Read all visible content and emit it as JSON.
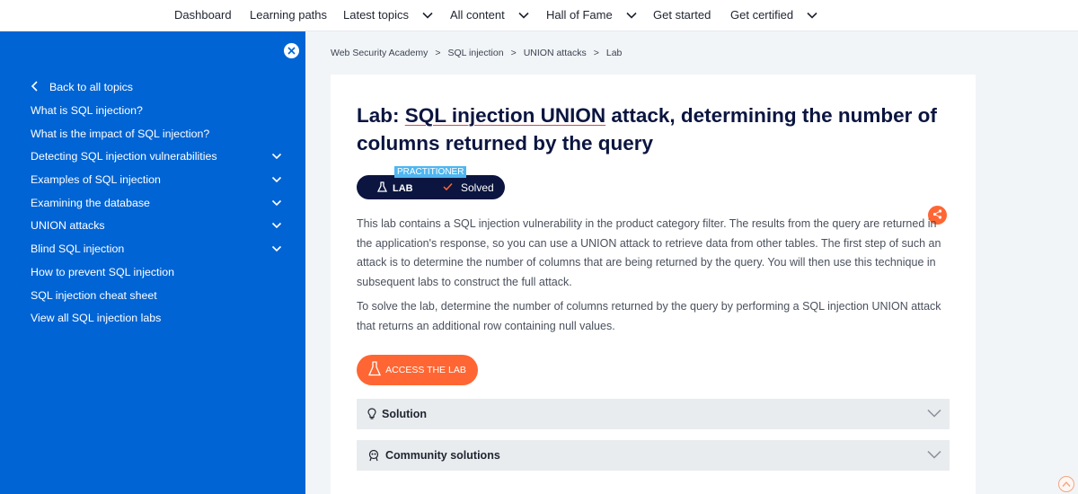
{
  "topnav": {
    "items": [
      {
        "label": "Dashboard",
        "has_dropdown": false
      },
      {
        "label": "Learning paths",
        "has_dropdown": false
      },
      {
        "label": "Latest topics",
        "has_dropdown": true
      },
      {
        "label": "All content",
        "has_dropdown": true
      },
      {
        "label": "Hall of Fame",
        "has_dropdown": true
      },
      {
        "label": "Get started",
        "has_dropdown": false
      },
      {
        "label": "Get certified",
        "has_dropdown": true
      }
    ]
  },
  "sidebar": {
    "back_label": "Back to all topics",
    "items": [
      {
        "label": "What is SQL injection?",
        "expandable": false
      },
      {
        "label": "What is the impact of SQL injection?",
        "expandable": false
      },
      {
        "label": "Detecting SQL injection vulnerabilities",
        "expandable": true
      },
      {
        "label": "Examples of SQL injection",
        "expandable": true
      },
      {
        "label": "Examining the database",
        "expandable": true
      },
      {
        "label": "UNION attacks",
        "expandable": true
      },
      {
        "label": "Blind SQL injection",
        "expandable": true
      },
      {
        "label": "How to prevent SQL injection",
        "expandable": false
      },
      {
        "label": "SQL injection cheat sheet",
        "expandable": false
      },
      {
        "label": "View all SQL injection labs",
        "expandable": false
      }
    ]
  },
  "breadcrumb": {
    "items": [
      "Web Security Academy",
      "SQL injection",
      "UNION attacks",
      "Lab"
    ],
    "separator": ">"
  },
  "lab": {
    "title_prefix": "Lab: ",
    "title_underlined": "SQL injection UNION",
    "title_rest": " attack, determining the number of columns returned by the query",
    "level": "PRACTITIONER",
    "badge_label": "LAB",
    "status": "Solved",
    "paragraph1": "This lab contains a SQL injection vulnerability in the product category filter. The results from the query are returned in the application's response, so you can use a UNION attack to retrieve data from other tables. The first step of such an attack is to determine the number of columns that are being returned by the query. You will then use this technique in subsequent labs to construct the full attack.",
    "paragraph2": "To solve the lab, determine the number of columns returned by the query by performing a SQL injection UNION attack that returns an additional row containing null values.",
    "access_button": "ACCESS THE LAB",
    "accordions": [
      {
        "label": "Solution",
        "icon": "lightbulb-icon"
      },
      {
        "label": "Community solutions",
        "icon": "community-icon"
      }
    ]
  },
  "colors": {
    "sidebar_bg": "#0064d4",
    "accent_orange": "#ff6633",
    "navy": "#0b1540",
    "practitioner_tag": "#4fb6f0"
  }
}
